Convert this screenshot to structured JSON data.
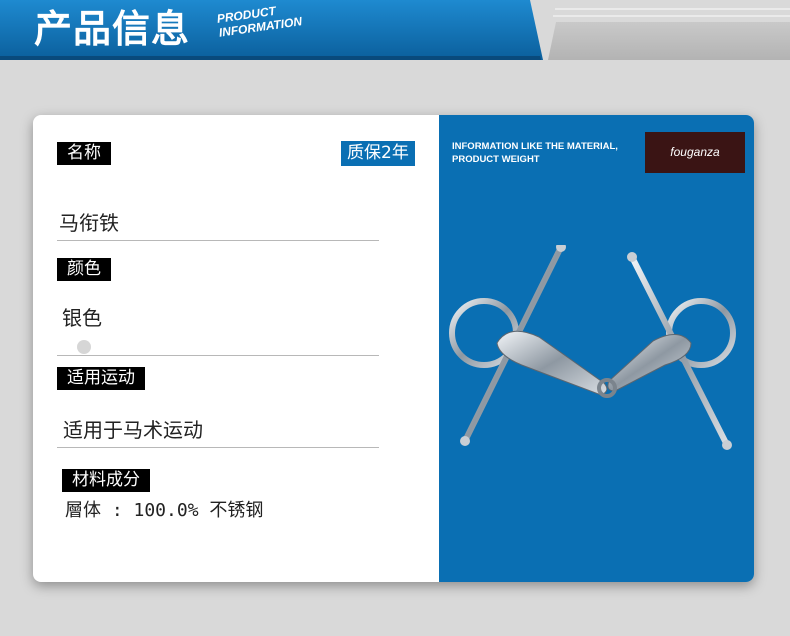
{
  "header": {
    "title_cn": "产品信息",
    "title_en_line1": "PRODUCT",
    "title_en_line2": "INFORMATION"
  },
  "fields": {
    "name_label": "名称",
    "warranty": "质保2年",
    "name_value": "马衔铁",
    "color_label": "颜色",
    "color_value": "银色",
    "usage_label": "适用运动",
    "usage_value": "适用于马术运动",
    "material_label": "材料成分",
    "material_value": "層体 : 100.0% 不锈钢"
  },
  "right_panel": {
    "info_text": "INFORMATION LIKE THE MATERIAL, PRODUCT WEIGHT",
    "brand_logo": "fouganza"
  },
  "colors": {
    "accent_blue": "#0a6fb3",
    "tag_black": "#000000",
    "swatch_silver": "#d6d6d6"
  }
}
